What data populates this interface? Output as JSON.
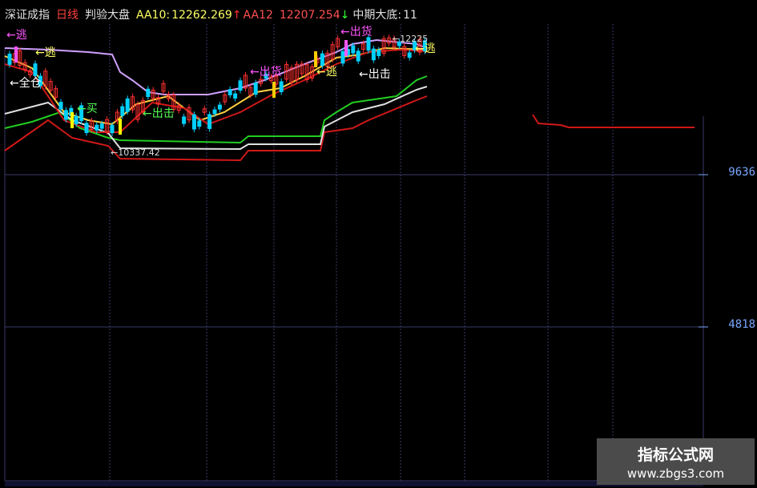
{
  "header": {
    "index_name": "深证成指",
    "period": "日线",
    "indicator": "判验大盘",
    "aa10_label": "AA10:",
    "aa10_value": "12262.269",
    "aa12_label": "AA12",
    "aa12_value": "12207.254",
    "mid_low_label": "中期大底:",
    "mid_low_value": "11"
  },
  "y_axis": {
    "labels": [
      {
        "text": "9636",
        "value": 9636
      },
      {
        "text": "4818",
        "value": 4818
      }
    ]
  },
  "annotations": [
    {
      "text": "←逃",
      "color": "#ff55ff"
    },
    {
      "text": "←逃",
      "color": "#ffff66"
    },
    {
      "text": "←全仓",
      "color": "#ffffff"
    },
    {
      "text": "←出货",
      "color": "#ff55ff"
    },
    {
      "text": "←出货",
      "color": "#ff55ff"
    },
    {
      "text": "←逃",
      "color": "#ffff66"
    },
    {
      "text": "←逃",
      "color": "#ffff66"
    },
    {
      "text": "←出击",
      "color": "#ffffff"
    },
    {
      "text": "←出击",
      "color": "#55ff55"
    },
    {
      "text": "←买",
      "color": "#55ff55"
    },
    {
      "text": "←10337.42",
      "color": "#dddddd"
    },
    {
      "text": "←12225",
      "color": "#dddddd"
    }
  ],
  "watermark": {
    "line1": "指标公式网",
    "line2": "www.zbgs3.com"
  },
  "colors": {
    "background": "#000000",
    "grid": "#3a3a6a",
    "up": "#ff3030",
    "down": "#00d0ff",
    "support_red": "#d01818",
    "support_green": "#22cc22",
    "support_white": "#e0e0e0",
    "envelope": "#d0a0ff",
    "axis_label": "#7aa7ff"
  },
  "chart_data": {
    "type": "line",
    "title": "深证成指 日线",
    "y_ticks": [
      9636,
      4818
    ],
    "series": [
      {
        "name": "AA10",
        "values": [
          12262.269
        ]
      },
      {
        "name": "AA12",
        "values": [
          12207.254
        ]
      }
    ],
    "low_annotation": 10337.42
  }
}
